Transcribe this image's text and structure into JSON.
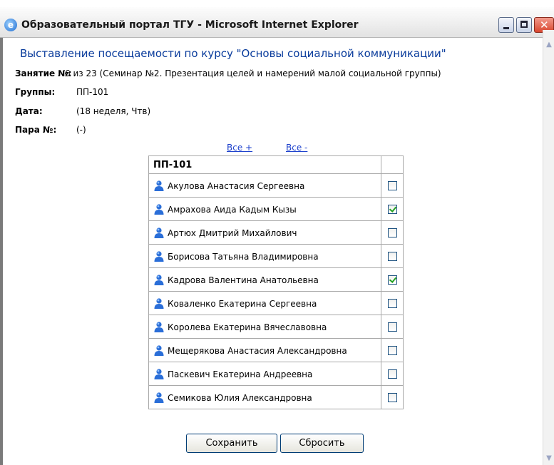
{
  "window": {
    "title": "Образовательный портал ТГУ - Microsoft Internet Explorer",
    "icon": "ie-logo-icon"
  },
  "page": {
    "heading": "Выставление посещаемости по курсу \"Основы социальной коммуникации\"",
    "lesson_label": "Занятие №:",
    "lesson_value": "6 из 23 (Семинар №2. Презентация целей и намерений малой социальной группы)",
    "groups_label": "Группы:",
    "groups_value": "ПП-101",
    "date_label": "Дата:",
    "date_value": "(18 неделя, Чтв)",
    "pair_label": "Пара №:",
    "pair_value": "(-)"
  },
  "links": {
    "all_plus": "Все +",
    "all_minus": "Все -"
  },
  "table": {
    "group_header": "ПП-101",
    "students": [
      {
        "name": "Акулова Анастасия Сергеевна",
        "present": false
      },
      {
        "name": "Амрахова Аида Кадым Кызы",
        "present": true
      },
      {
        "name": "Артюх Дмитрий Михайлович",
        "present": false
      },
      {
        "name": "Борисова Татьяна Владимировна",
        "present": false
      },
      {
        "name": "Кадрова Валентина Анатольевна",
        "present": true
      },
      {
        "name": "Коваленко Екатерина Сергеевна",
        "present": false
      },
      {
        "name": "Королева Екатерина Вячеславовна",
        "present": false
      },
      {
        "name": "Мещерякова Анастасия Александровна",
        "present": false
      },
      {
        "name": "Паскевич Екатерина Андреевна",
        "present": false
      },
      {
        "name": "Семикова Юлия Александровна",
        "present": false
      }
    ]
  },
  "buttons": {
    "save": "Сохранить",
    "reset": "Сбросить"
  },
  "colors": {
    "heading": "#0a3c9c",
    "link": "#1b3fcc",
    "check": "#21a121"
  }
}
